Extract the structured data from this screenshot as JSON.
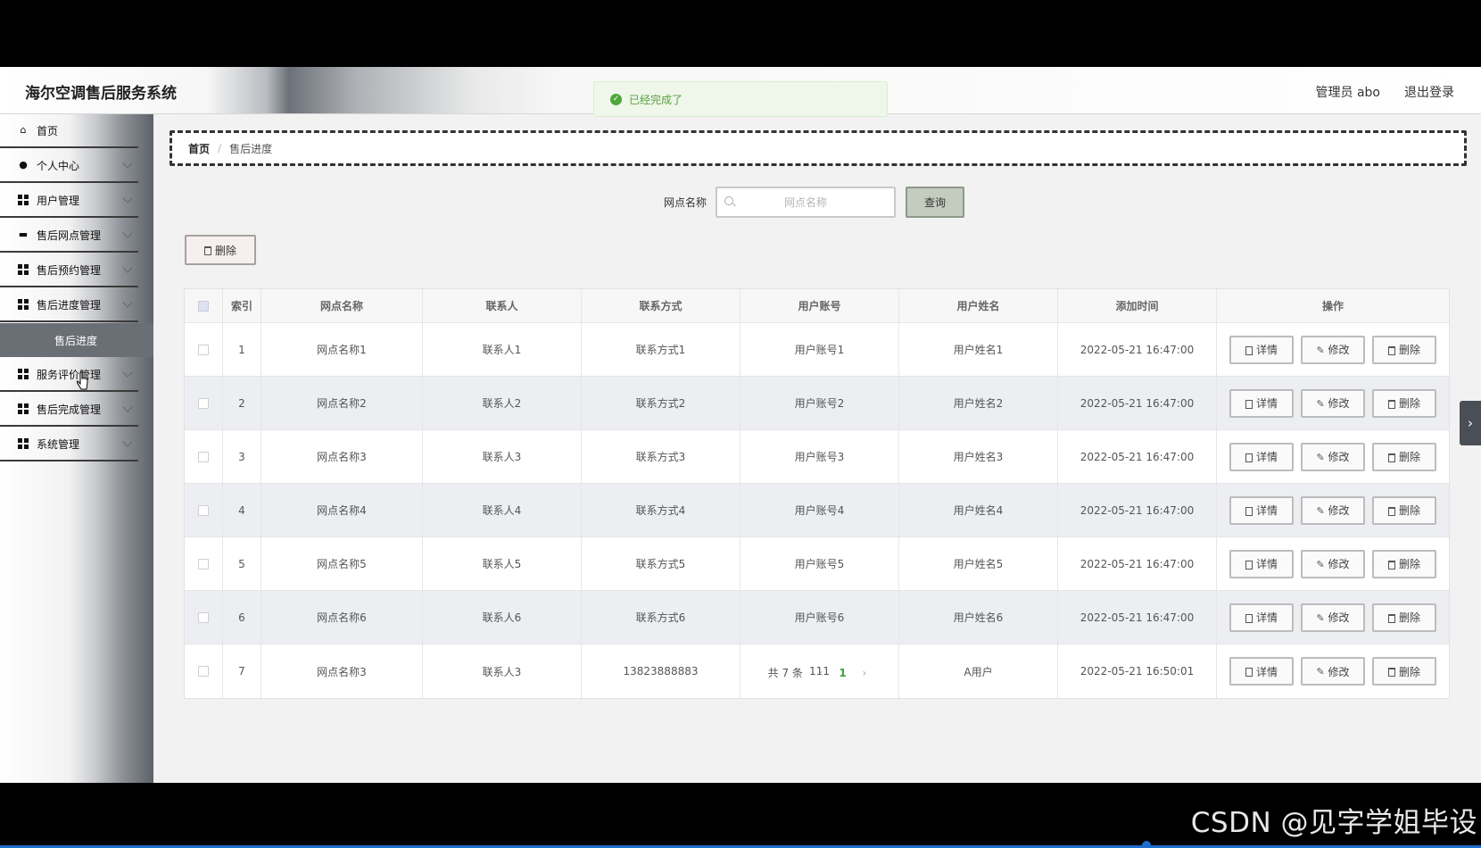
{
  "app": {
    "title": "海尔空调售后服务系统"
  },
  "header": {
    "user": "管理员 abo",
    "logout": "退出登录"
  },
  "toast": {
    "text": "已经完成了"
  },
  "sidebar": {
    "items": [
      {
        "label": "首页",
        "icon": "home-icon"
      },
      {
        "label": "个人中心",
        "icon": "user-icon"
      },
      {
        "label": "用户管理",
        "icon": "grid-icon"
      },
      {
        "label": "售后网点管理",
        "icon": "monitor-icon"
      },
      {
        "label": "售后预约管理",
        "icon": "grid-icon"
      },
      {
        "label": "售后进度管理",
        "icon": "grid-icon"
      },
      {
        "label": "服务评价管理",
        "icon": "grid-icon"
      },
      {
        "label": "售后完成管理",
        "icon": "grid-icon"
      },
      {
        "label": "系统管理",
        "icon": "grid-icon"
      }
    ],
    "active_sub": "售后进度"
  },
  "breadcrumb": {
    "home": "首页",
    "separator": "/",
    "current": "售后进度"
  },
  "search": {
    "label": "网点名称",
    "placeholder": "网点名称",
    "button": "查询"
  },
  "toolbar": {
    "delete_label": "删除"
  },
  "table": {
    "columns": [
      "索引",
      "网点名称",
      "联系人",
      "联系方式",
      "用户账号",
      "用户姓名",
      "添加时间",
      "操作"
    ],
    "actions": {
      "detail": "详情",
      "edit": "修改",
      "delete": "删除"
    },
    "rows": [
      [
        "1",
        "网点名称1",
        "联系人1",
        "联系方式1",
        "用户账号1",
        "用户姓名1",
        "2022-05-21 16:47:00"
      ],
      [
        "2",
        "网点名称2",
        "联系人2",
        "联系方式2",
        "用户账号2",
        "用户姓名2",
        "2022-05-21 16:47:00"
      ],
      [
        "3",
        "网点名称3",
        "联系人3",
        "联系方式3",
        "用户账号3",
        "用户姓名3",
        "2022-05-21 16:47:00"
      ],
      [
        "4",
        "网点名称4",
        "联系人4",
        "联系方式4",
        "用户账号4",
        "用户姓名4",
        "2022-05-21 16:47:00"
      ],
      [
        "5",
        "网点名称5",
        "联系人5",
        "联系方式5",
        "用户账号5",
        "用户姓名5",
        "2022-05-21 16:47:00"
      ],
      [
        "6",
        "网点名称6",
        "联系人6",
        "联系方式6",
        "用户账号6",
        "用户姓名6",
        "2022-05-21 16:47:00"
      ],
      [
        "7",
        "网点名称3",
        "联系人3",
        "13823888883",
        "111",
        "A用户",
        "2022-05-21 16:50:01"
      ]
    ]
  },
  "pagination": {
    "total": "共 7 条",
    "prev": "‹",
    "current_page": "1",
    "next": "›"
  },
  "side_tab": {
    "icon": "chevron-right-icon",
    "glyph": "›"
  },
  "watermark": "CSDN @见字学姐毕设",
  "colors": {
    "accent": "#409e3a",
    "sidebar_active": "#6a6f76",
    "toast_text": "#5b9f42"
  }
}
